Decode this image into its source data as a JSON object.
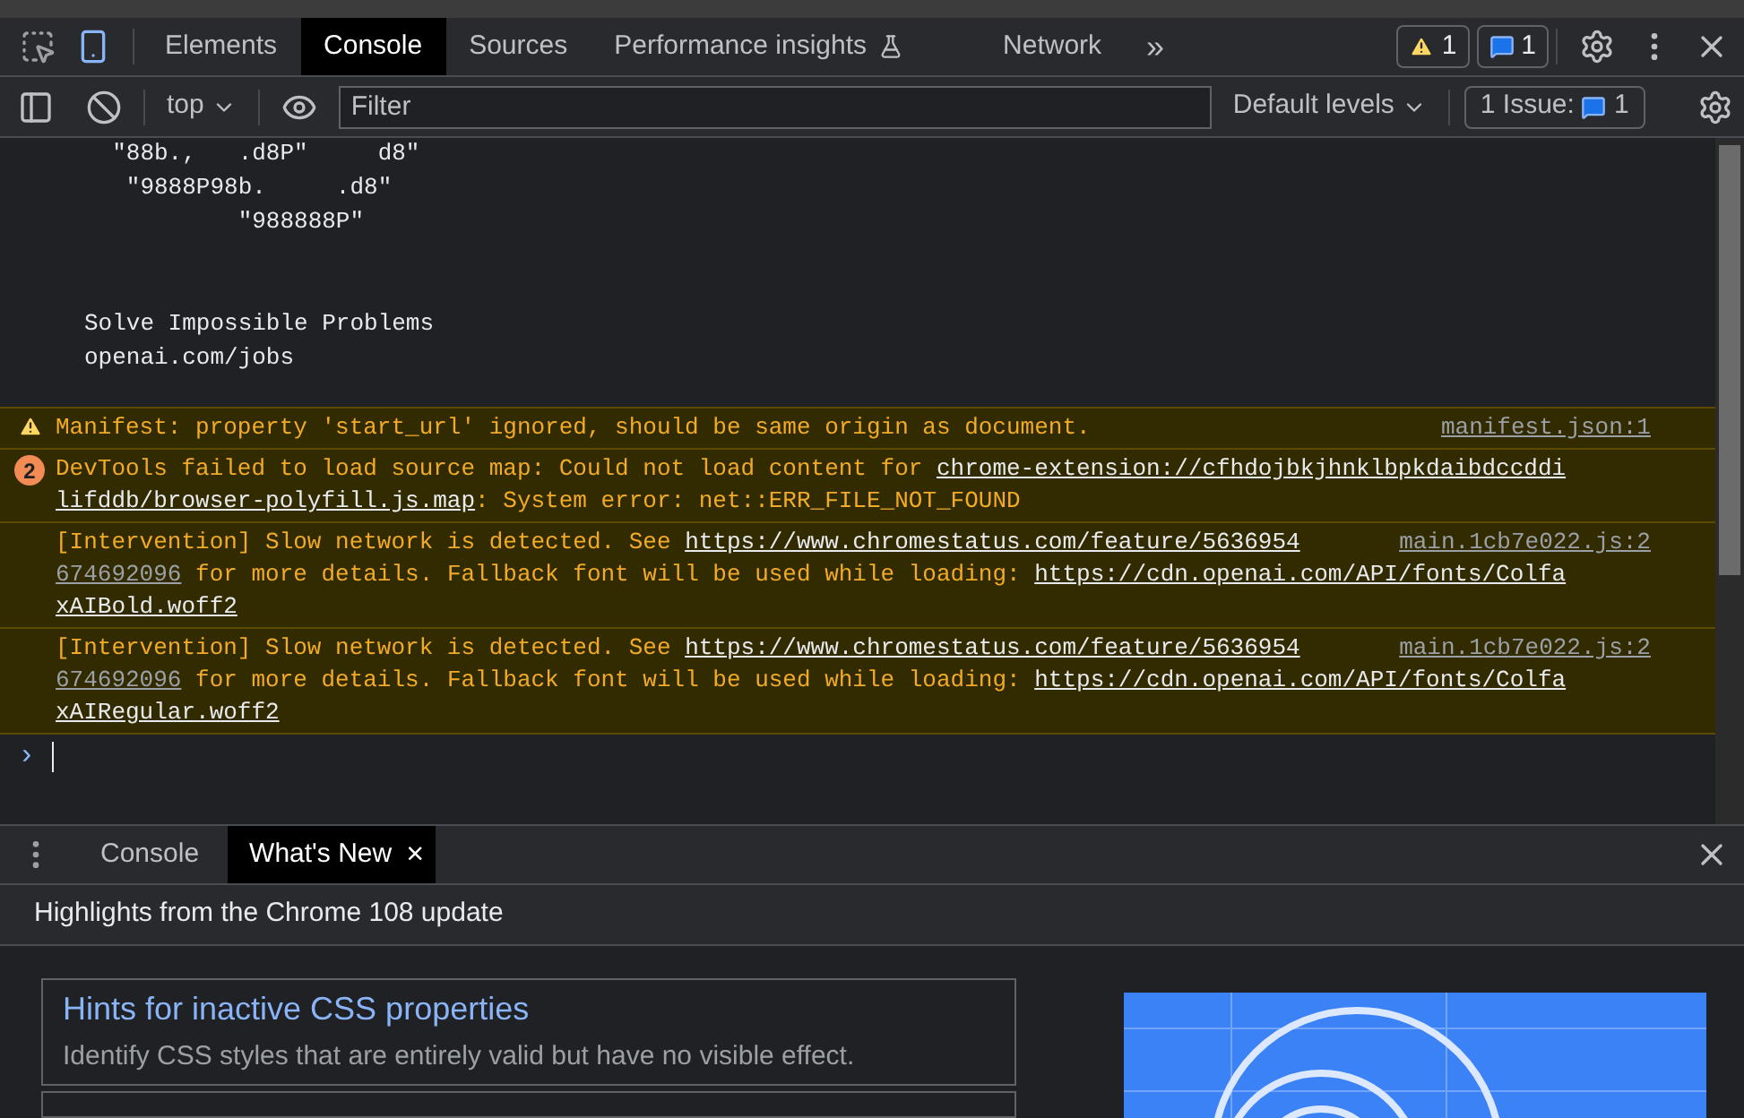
{
  "main_tabs": [
    {
      "label": "Elements",
      "selected": false
    },
    {
      "label": "Console",
      "selected": true
    },
    {
      "label": "Sources",
      "selected": false
    },
    {
      "label": "Performance insights",
      "selected": false,
      "flask": true
    },
    {
      "label": "Network",
      "selected": false
    }
  ],
  "more_tabs": "»",
  "warnings_count": "1",
  "messages_count": "1",
  "console_toolbar": {
    "context": "top",
    "filter_placeholder": "Filter",
    "levels": "Default levels",
    "issues_label": "1 Issue:",
    "issues_count": "1"
  },
  "ascii_art": [
    "  ″88b.,   .d8P″     d8″",
    "   ″9888P98b.     .d8″",
    "           ″988888P″"
  ],
  "log_lines": [
    "Solve Impossible Problems",
    "openai.com/jobs"
  ],
  "messages": [
    {
      "kind": "warning",
      "lines": [
        [
          {
            "kind": "text",
            "text": "Manifest: property 'start_url' ignored, should be same origin as document."
          },
          {
            "kind": "source",
            "text": "manifest.json:1"
          }
        ]
      ]
    },
    {
      "kind": "repeated",
      "count": "2",
      "lines": [
        [
          {
            "kind": "text",
            "text": "DevTools failed to load source map: Could not load content for "
          },
          {
            "kind": "link",
            "text": "chrome-extension://cfhdojbkjhnklbpkdaibdccddi"
          }
        ],
        [
          {
            "kind": "link",
            "text": "lifddb/browser-polyfill.js.map"
          },
          {
            "kind": "text",
            "text": ": System error: net::ERR_FILE_NOT_FOUND"
          }
        ]
      ]
    },
    {
      "kind": "plain",
      "lines": [
        [
          {
            "kind": "text",
            "text": "[Intervention] Slow network is detected. See "
          },
          {
            "kind": "link",
            "text": "https://www.chromestatus.com/feature/5636954"
          },
          {
            "kind": "source",
            "text": "main.1cb7e022.js:2"
          }
        ],
        [
          {
            "kind": "source",
            "text": "674692096"
          },
          {
            "kind": "text",
            "text": " for more details. Fallback font will be used while loading: "
          },
          {
            "kind": "link",
            "text": "https://cdn.openai.com/API/fonts/Colfa"
          }
        ],
        [
          {
            "kind": "link",
            "text": "xAIBold.woff2"
          }
        ]
      ]
    },
    {
      "kind": "plain",
      "lines": [
        [
          {
            "kind": "text",
            "text": "[Intervention] Slow network is detected. See "
          },
          {
            "kind": "link",
            "text": "https://www.chromestatus.com/feature/5636954"
          },
          {
            "kind": "source",
            "text": "main.1cb7e022.js:2"
          }
        ],
        [
          {
            "kind": "source",
            "text": "674692096"
          },
          {
            "kind": "text",
            "text": " for more details. Fallback font will be used while loading: "
          },
          {
            "kind": "link",
            "text": "https://cdn.openai.com/API/fonts/Colfa"
          }
        ],
        [
          {
            "kind": "link",
            "text": "xAIRegular.woff2"
          }
        ]
      ]
    }
  ],
  "prompt": "›",
  "drawer_tabs": [
    {
      "label": "Console",
      "selected": false,
      "closable": false
    },
    {
      "label": "What's New",
      "selected": true,
      "closable": true
    }
  ],
  "close_glyph": "×",
  "whats_new": {
    "heading": "Highlights from the Chrome 108 update",
    "cards": [
      {
        "title": "Hints for inactive CSS properties",
        "description": "Identify CSS styles that are entirely valid but have no visible effect."
      }
    ]
  }
}
